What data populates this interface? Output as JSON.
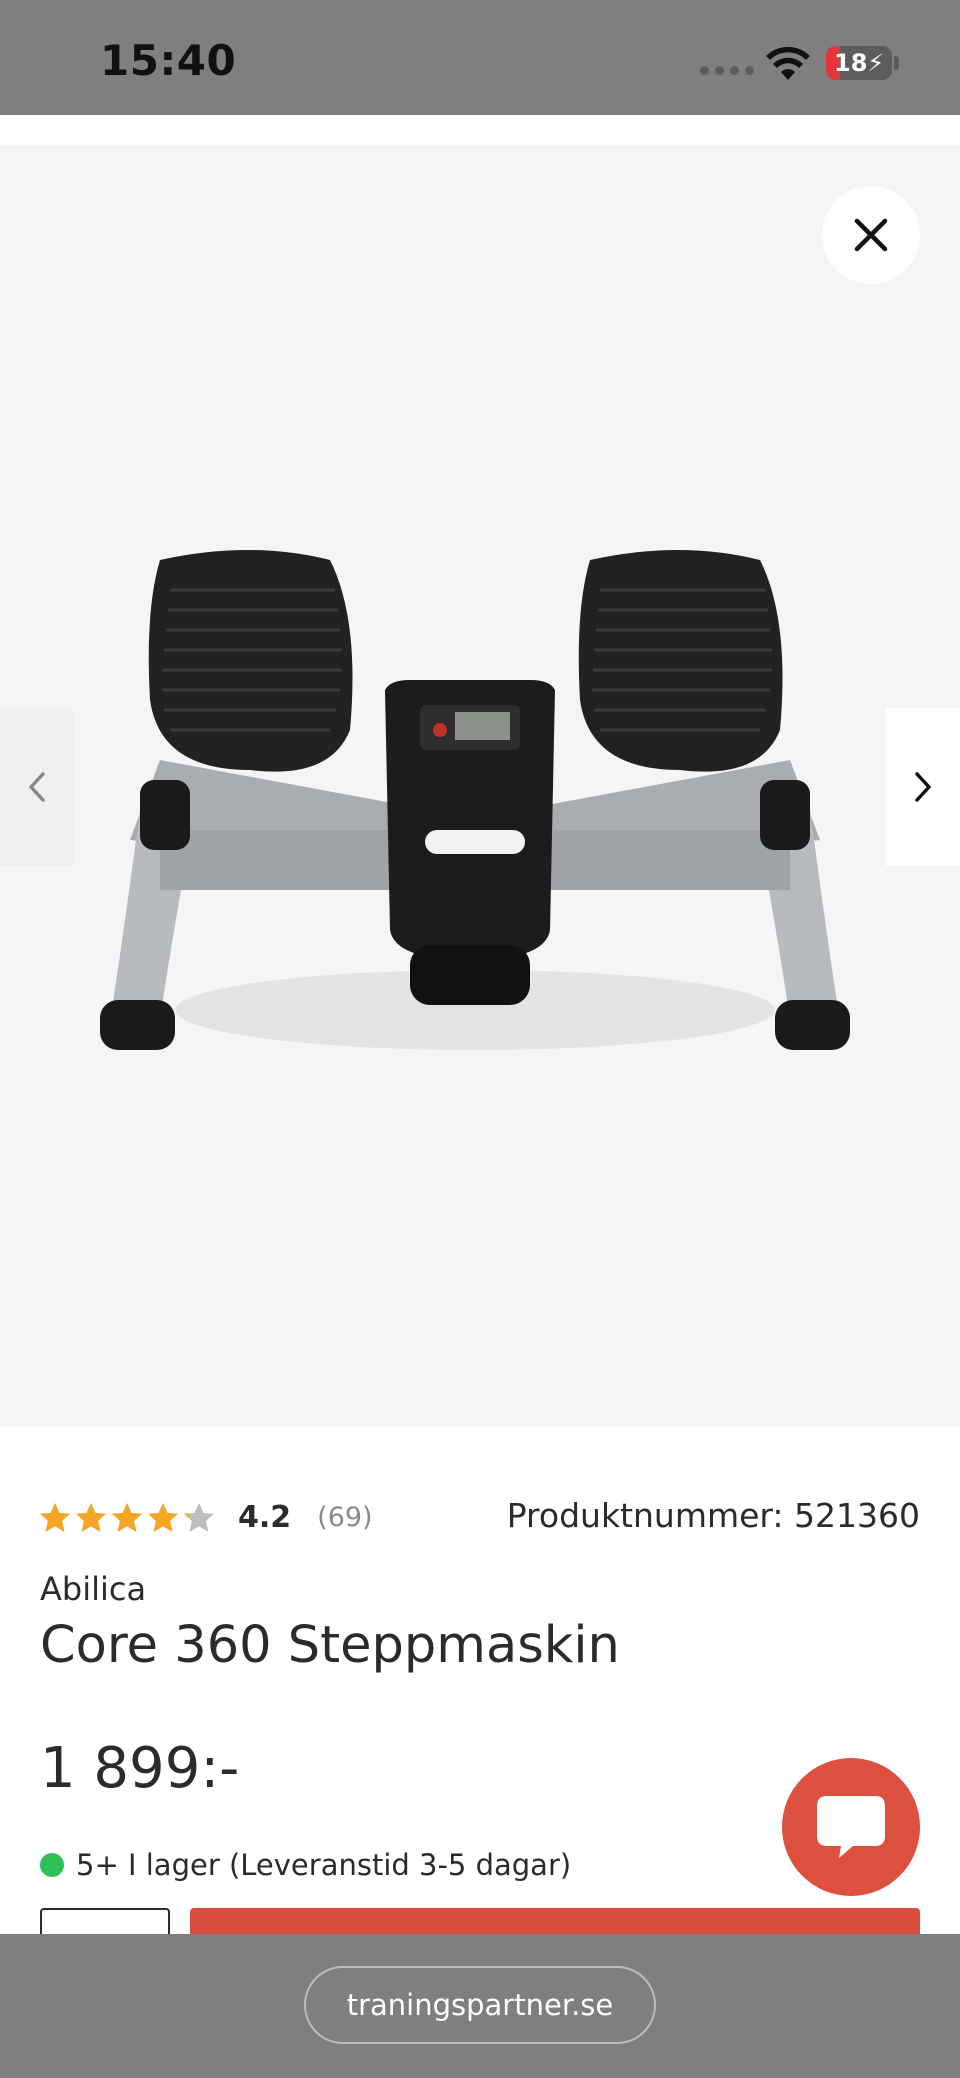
{
  "status_bar": {
    "time": "15:40",
    "battery_level": "18"
  },
  "gallery": {
    "image_alt": "Twist stepper"
  },
  "product": {
    "rating_value": "4.2",
    "rating_count": "(69)",
    "stars": 4.2,
    "product_number": "Produktnummer: 521360",
    "brand": "Abilica",
    "title": "Core 360 Steppmaskin",
    "price": "1 899:-",
    "stock_text": "5+ I lager (Leveranstid 3-5 dagar)"
  },
  "browser": {
    "url": "traningspartner.se"
  },
  "colors": {
    "accent": "#d94c3e",
    "star": "#f5a623",
    "stock": "#2fbf56"
  }
}
